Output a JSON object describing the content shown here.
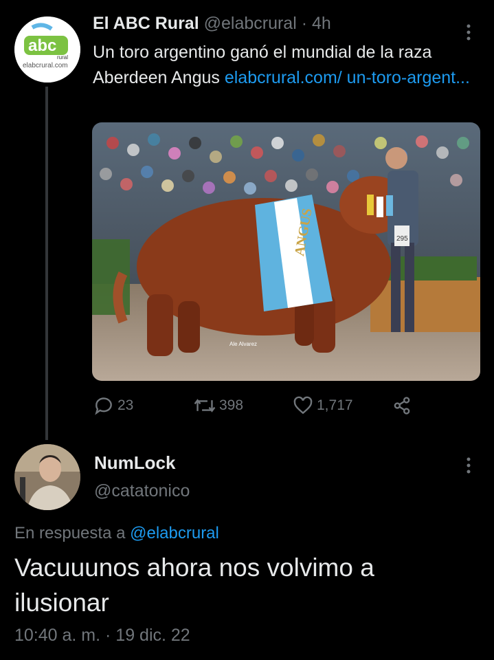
{
  "tweet": {
    "author_name": "El ABC Rural",
    "author_handle": "@elabcrural",
    "age": "· 4h",
    "text": "Un toro argentino ganó el mundial de la raza Aberdeen Angus ",
    "link_text": "elabcrural.com/ un-toro-argent...",
    "avatar": {
      "logo_text": "abc",
      "logo_sub": "rural",
      "domain": "elabcrural.com"
    },
    "photo": {
      "credit": "Ale Alvarez",
      "banner": "ANGUS",
      "tag": "295"
    },
    "replies": "23",
    "retweets": "398",
    "likes": "1,717",
    "more_label": "⋮"
  },
  "reply": {
    "author_name": "NumLock",
    "author_handle": "@catatonico",
    "reply_prefix": "En respuesta a ",
    "reply_to": "@elabcrural",
    "text": "Vacuuunos ahora nos volvimo a ilusionar",
    "timestamp": "10:40 a. m. · 19 dic. 22",
    "more_label": "⋮"
  },
  "colors": {
    "background": "#000000",
    "text": "#e7e9ea",
    "muted": "#71767b",
    "link": "#1d9bf0"
  },
  "icons": [
    "reply-icon",
    "retweet-icon",
    "like-icon",
    "share-icon",
    "more-icon"
  ]
}
